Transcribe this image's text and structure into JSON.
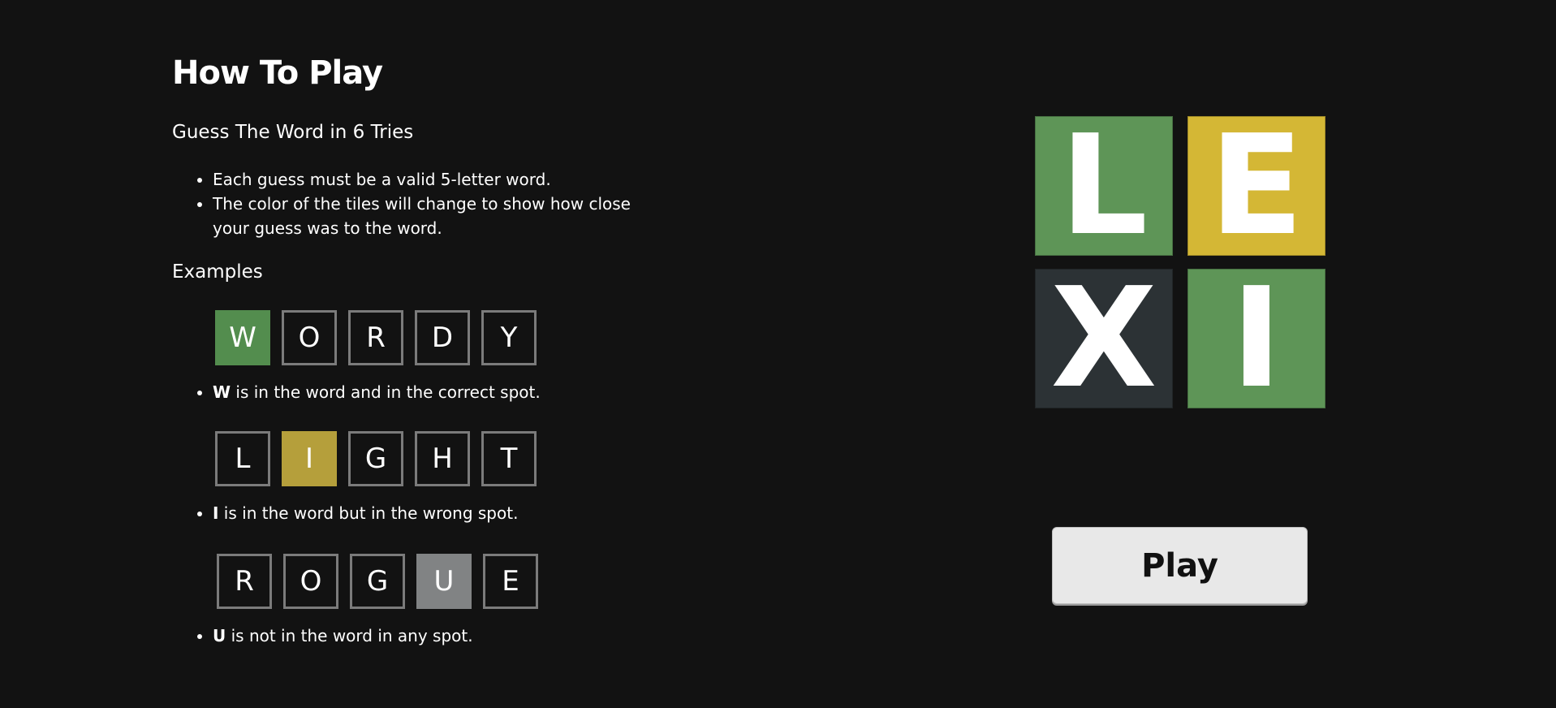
{
  "rules": {
    "title": "How To Play",
    "subtitle": "Guess The Word in 6 Tries",
    "bullets": [
      "Each guess must be a valid 5-letter word.",
      "The color of the tiles will change to show how close your guess was to the word."
    ],
    "examples_heading": "Examples",
    "examples": [
      {
        "word": [
          "W",
          "O",
          "R",
          "D",
          "Y"
        ],
        "states": [
          "correct",
          "empty",
          "empty",
          "empty",
          "empty"
        ],
        "letter": "W",
        "caption": " is in the word and in the correct spot."
      },
      {
        "word": [
          "L",
          "I",
          "G",
          "H",
          "T"
        ],
        "states": [
          "empty",
          "present",
          "empty",
          "empty",
          "empty"
        ],
        "letter": "I",
        "caption": " is in the word but in the wrong spot."
      },
      {
        "word": [
          "R",
          "O",
          "G",
          "U",
          "E"
        ],
        "states": [
          "empty",
          "empty",
          "empty",
          "absent",
          "empty"
        ],
        "letter": "U",
        "caption": " is not in the word in any spot."
      }
    ]
  },
  "logo": {
    "letters": [
      "L",
      "E",
      "X",
      "I"
    ],
    "colors": [
      "#5e9557",
      "#d4b735",
      "#2c3235",
      "#5e9557"
    ]
  },
  "play_button": {
    "label": "Play"
  },
  "colors": {
    "background": "#121212",
    "correct": "#538d4e",
    "present": "#b59f3b",
    "absent": "#818384",
    "tile_border": "#7b7b7b"
  }
}
